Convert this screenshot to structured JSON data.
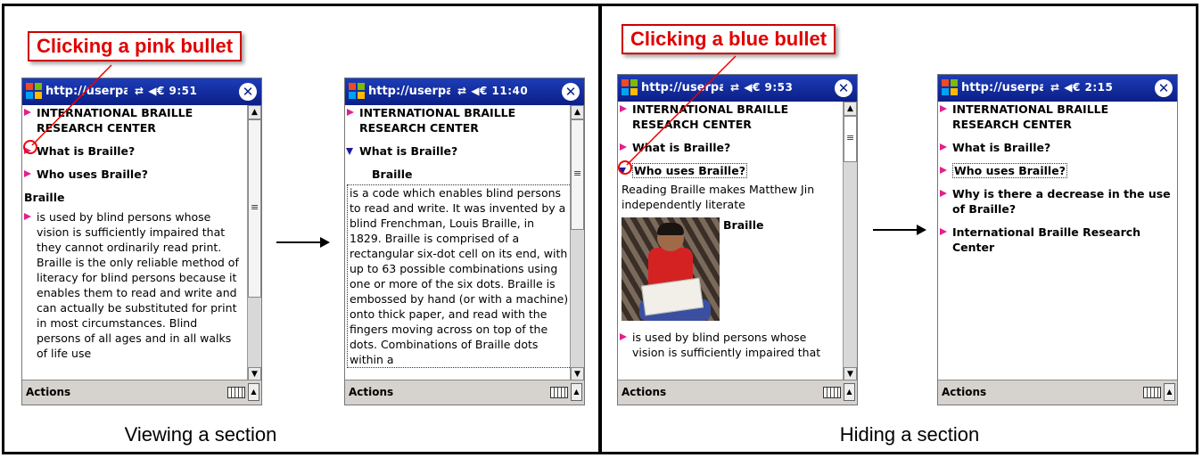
{
  "left_panel": {
    "callout": "Clicking a pink bullet",
    "caption": "Viewing a section",
    "screen_a": {
      "url": "http://userpages.u",
      "status": "⇄ ◀€ 9:51",
      "items": {
        "title1": "INTERNATIONAL BRAILLE",
        "title2": "RESEARCH CENTER",
        "what": "What is Braille?",
        "who": "Who uses Braille?",
        "heading": "Braille",
        "body": "is used by blind persons whose vision is sufficiently impaired that they cannot ordinarily read print. Braille is the only reliable method of literacy for blind persons because it enables them to read and write and can actually be substituted for print in most circumstances. Blind persons of all ages and in all walks of life use"
      },
      "menu": "Actions"
    },
    "screen_b": {
      "url": "http://userpages.",
      "status": "⇄ ◀€ 11:40",
      "items": {
        "title1": "INTERNATIONAL BRAILLE",
        "title2": "RESEARCH CENTER",
        "what": "What is Braille?",
        "heading": "Braille",
        "body": "is a code which enables blind persons to read and write. It was invented by a blind Frenchman, Louis Braille, in 1829. Braille is comprised of a rectangular six-dot cell on its end, with up to 63 possible combinations using one or more of the six dots. Braille is embossed by hand (or with a machine) onto thick paper, and read with the fingers moving across on top of the dots. Combinations of Braille dots within a"
      },
      "menu": "Actions"
    }
  },
  "right_panel": {
    "callout": "Clicking a blue bullet",
    "caption": "Hiding a section",
    "screen_c": {
      "url": "http://userpages.u",
      "status": "⇄ ◀€ 9:53",
      "items": {
        "title1": "INTERNATIONAL BRAILLE",
        "title2": "RESEARCH CENTER",
        "what": "What is Braille?",
        "who": "Who uses Braille?",
        "reading": "Reading Braille makes Matthew Jin independently literate",
        "photo_caption": "Braille",
        "body": "is used by blind persons whose vision is sufficiently impaired that"
      },
      "menu": "Actions"
    },
    "screen_d": {
      "url": "http://userpages.u",
      "status": "⇄ ◀€ 2:15",
      "items": {
        "title1": "INTERNATIONAL BRAILLE",
        "title2": "RESEARCH CENTER",
        "what": "What is Braille?",
        "who": "Who uses Braille?",
        "why": "Why is there a decrease in the use of Braille?",
        "ibrc": "International Braille Research Center"
      },
      "menu": "Actions"
    }
  },
  "colors": {
    "pink_bullet": "#e0208c",
    "blue_bullet": "#1a1a9c",
    "callout_text": "#e00000",
    "titlebar": "#0b1f86"
  }
}
